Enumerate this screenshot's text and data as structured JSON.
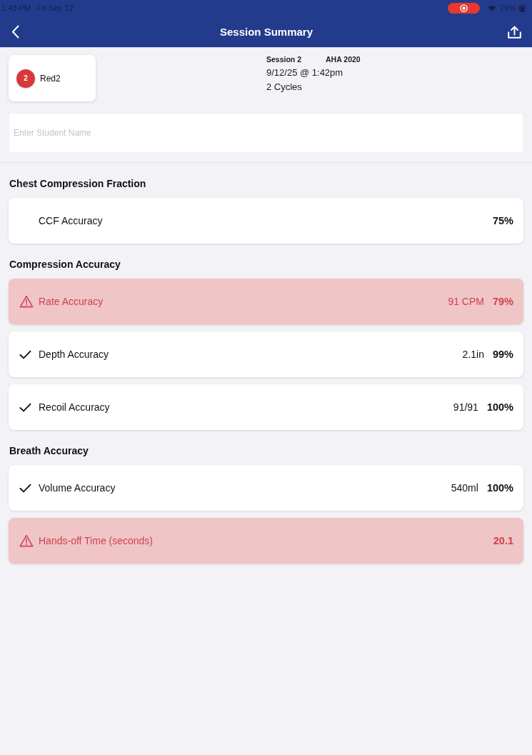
{
  "status_bar": {
    "time": "1:43 PM",
    "date": "Fri Sep 12",
    "recording": true,
    "battery": "29%"
  },
  "nav": {
    "title": "Session Summary"
  },
  "student": {
    "badge": "2",
    "name": "Red2"
  },
  "session": {
    "number": "Session 2",
    "guideline": "AHA 2020",
    "datetime": "9/12/25 @ 1:42pm",
    "cycles": "2 Cycles"
  },
  "student_name_field": {
    "placeholder": "Enter Student Name"
  },
  "sections": [
    {
      "title": "Chest Compression Fraction",
      "rows": [
        {
          "kind": "plain",
          "label": "CCF Accuracy",
          "score": "75%"
        }
      ]
    },
    {
      "title": "Compression Accuracy",
      "rows": [
        {
          "kind": "alert",
          "label": "Rate Accuracy",
          "reading": "91 CPM",
          "score": "79%"
        },
        {
          "kind": "pass",
          "label": "Depth Accuracy",
          "reading": "2.1in",
          "score": "99%"
        },
        {
          "kind": "pass",
          "label": "Recoil Accuracy",
          "reading": "91/91",
          "score": "100%"
        }
      ]
    },
    {
      "title": "Breath Accuracy",
      "rows": [
        {
          "kind": "pass",
          "label": "Volume Accuracy",
          "reading": "540ml",
          "score": "100%"
        },
        {
          "kind": "alert",
          "label": "Hands-off Time (seconds)",
          "score": "20.1"
        }
      ]
    }
  ]
}
